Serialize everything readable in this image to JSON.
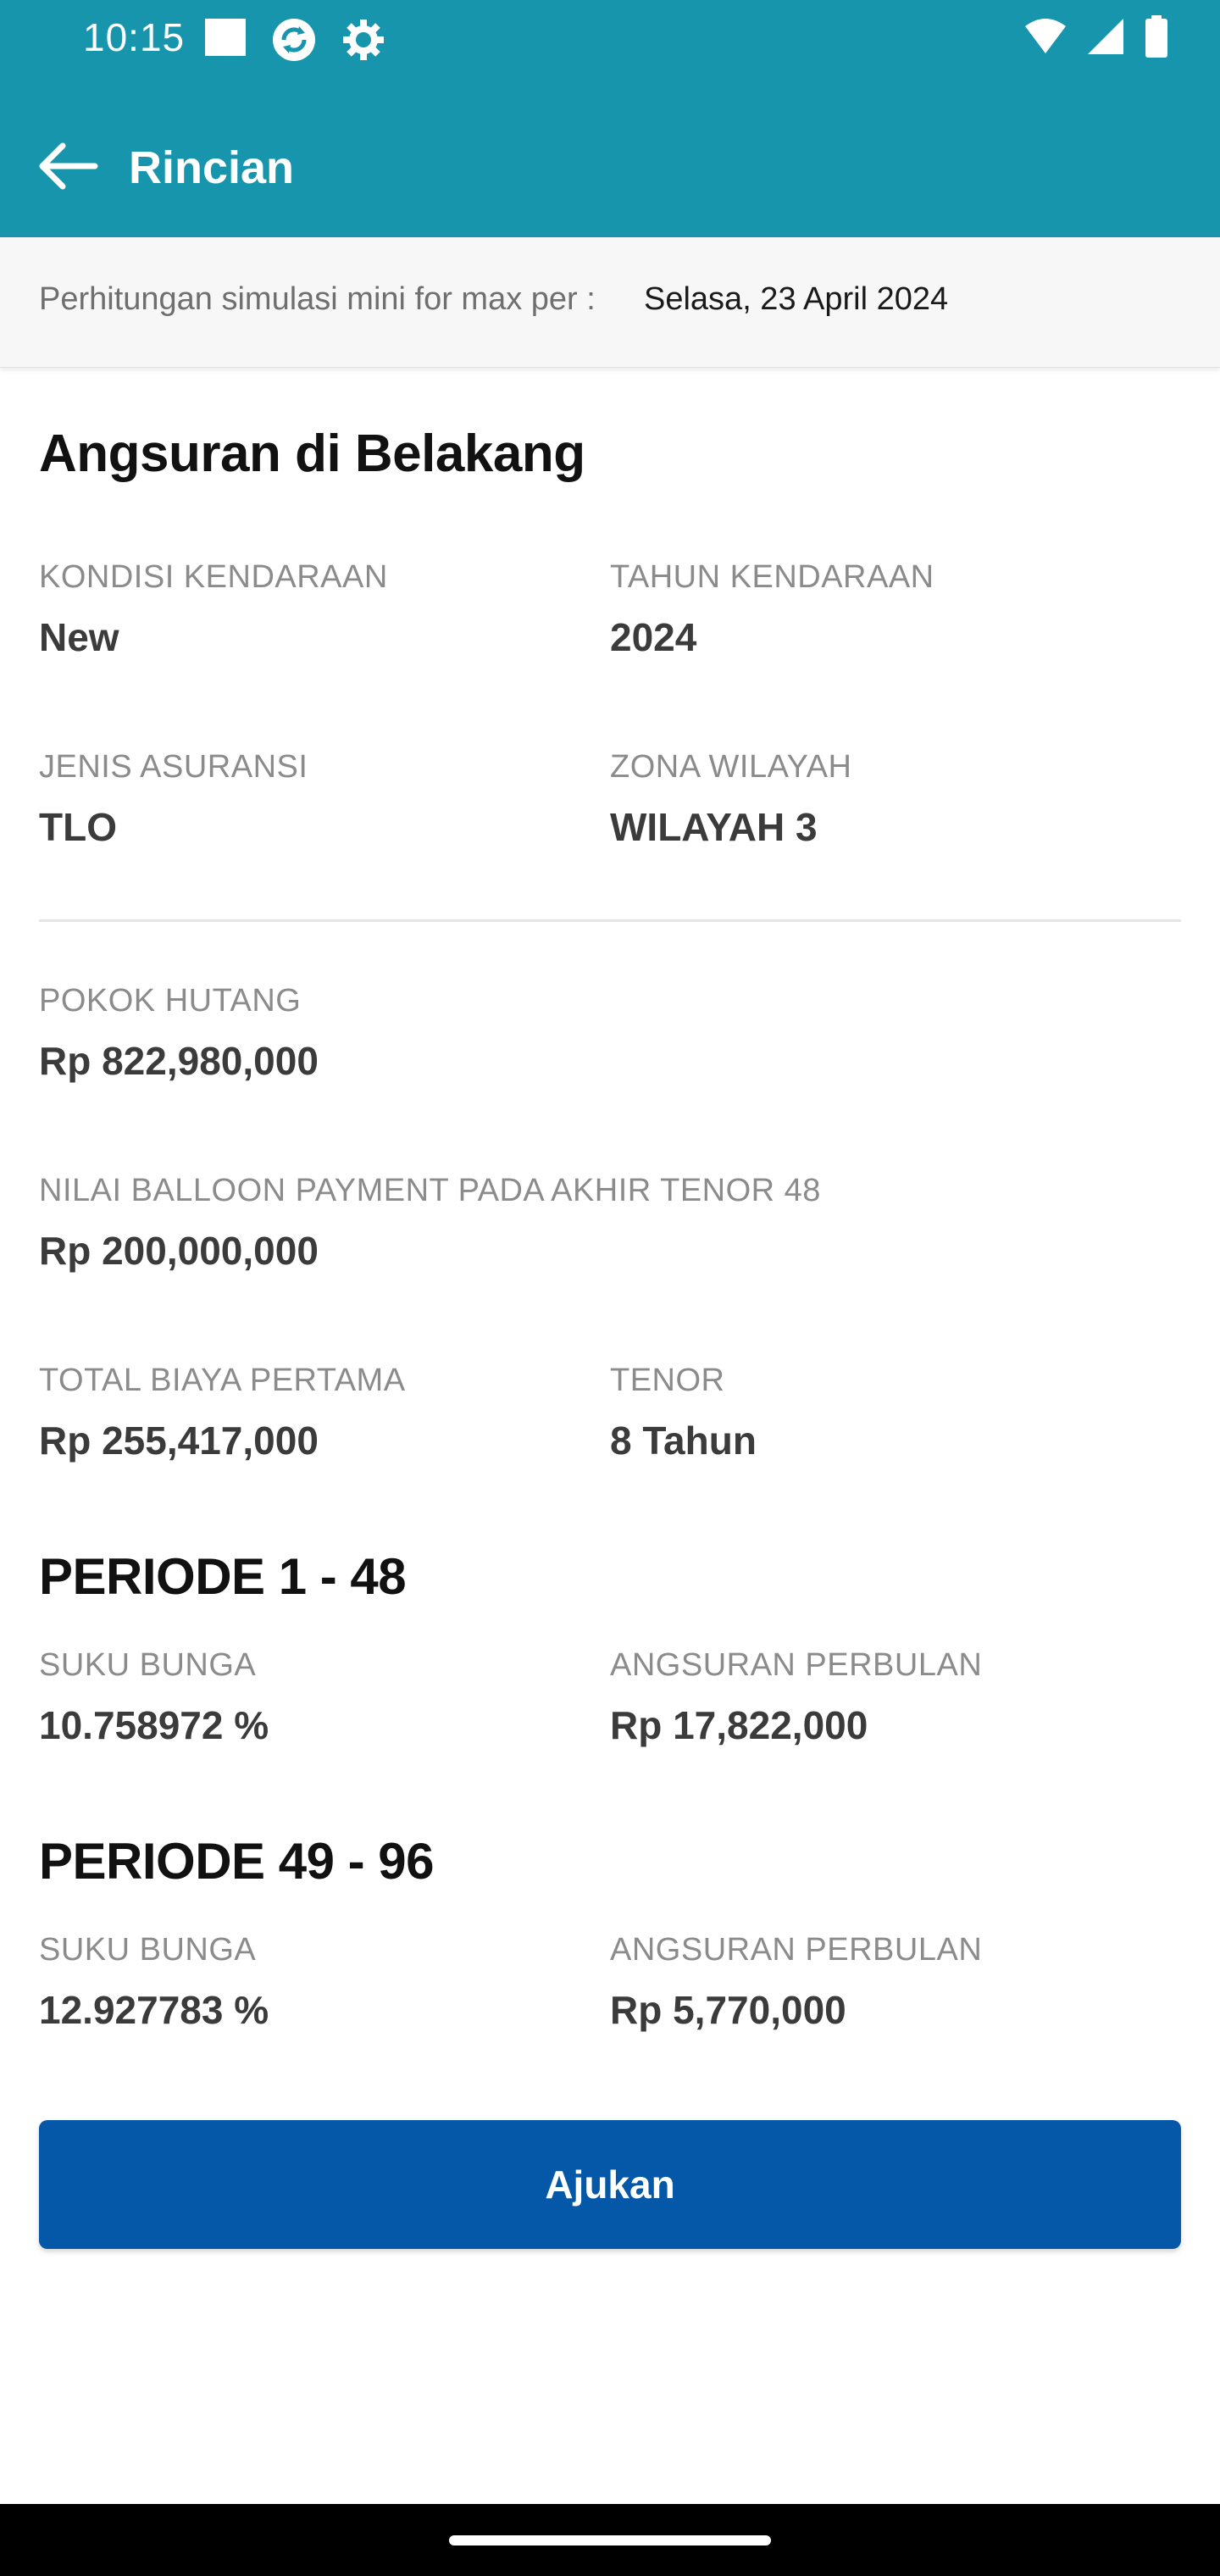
{
  "status_bar": {
    "time": "10:15",
    "left_icons": [
      "notification-square-icon",
      "sync-icon",
      "settings-gear-icon"
    ],
    "right_icons": [
      "wifi-icon",
      "cell-signal-icon",
      "battery-icon"
    ]
  },
  "header": {
    "title": "Rincian",
    "back_icon": "arrow-left-icon"
  },
  "simulation": {
    "label": "Perhitungan simulasi mini for max per :",
    "date": "Selasa, 23 April 2024"
  },
  "section": {
    "title": "Angsuran di Belakang"
  },
  "vehicle": {
    "condition_label": "KONDISI KENDARAAN",
    "condition_value": "New",
    "year_label": "TAHUN KENDARAAN",
    "year_value": "2024",
    "insurance_label": "JENIS ASURANSI",
    "insurance_value": "TLO",
    "zone_label": "ZONA WILAYAH",
    "zone_value": "WILAYAH 3"
  },
  "loan": {
    "principal_label": "POKOK HUTANG",
    "principal_value": "Rp 822,980,000",
    "balloon_label": "NILAI BALLOON PAYMENT PADA AKHIR TENOR 48",
    "balloon_value": "Rp 200,000,000",
    "first_cost_label": "TOTAL BIAYA PERTAMA",
    "first_cost_value": "Rp 255,417,000",
    "tenor_label": "TENOR",
    "tenor_value": "8 Tahun"
  },
  "periods": [
    {
      "title": "PERIODE 1 - 48",
      "rate_label": "SUKU BUNGA",
      "rate_value": "10.758972 %",
      "installment_label": "ANGSURAN PERBULAN",
      "installment_value": "Rp 17,822,000"
    },
    {
      "title": "PERIODE 49 - 96",
      "rate_label": "SUKU BUNGA",
      "rate_value": "12.927783 %",
      "installment_label": "ANGSURAN PERBULAN",
      "installment_value": "Rp 5,770,000"
    }
  ],
  "actions": {
    "submit_label": "Ajukan"
  },
  "colors": {
    "header_bg": "#1795ad",
    "button_bg": "#0557a8"
  }
}
